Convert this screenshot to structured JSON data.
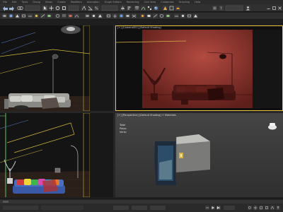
{
  "menu": [
    "File",
    "Edit",
    "Tools",
    "Group",
    "Views",
    "Create",
    "Modifiers",
    "Animation",
    "Graph Editors",
    "Rendering",
    "Civil View",
    "Customize",
    "Scripting",
    "Help"
  ],
  "viewports": {
    "top_right_label": "[+] [Camera001] [Default Shading]",
    "bottom_right_label": "[+] [Perspective] [Default Shading] + Materials",
    "stats": [
      "Total",
      "Polys:",
      "Verts:"
    ]
  },
  "colors": {
    "ui_bg": "#1f1f1f",
    "viewport_dark": "#121212",
    "red_render": "#7a2a24",
    "perspective_bg": "#3b3b3b",
    "active_border": "#e6c43a",
    "gizmo_yellow": "#d1b43b"
  },
  "icons": [
    "select-icon",
    "move-icon",
    "rotate-icon",
    "scale-icon",
    "render-icon",
    "teapot-icon",
    "play-icon"
  ]
}
